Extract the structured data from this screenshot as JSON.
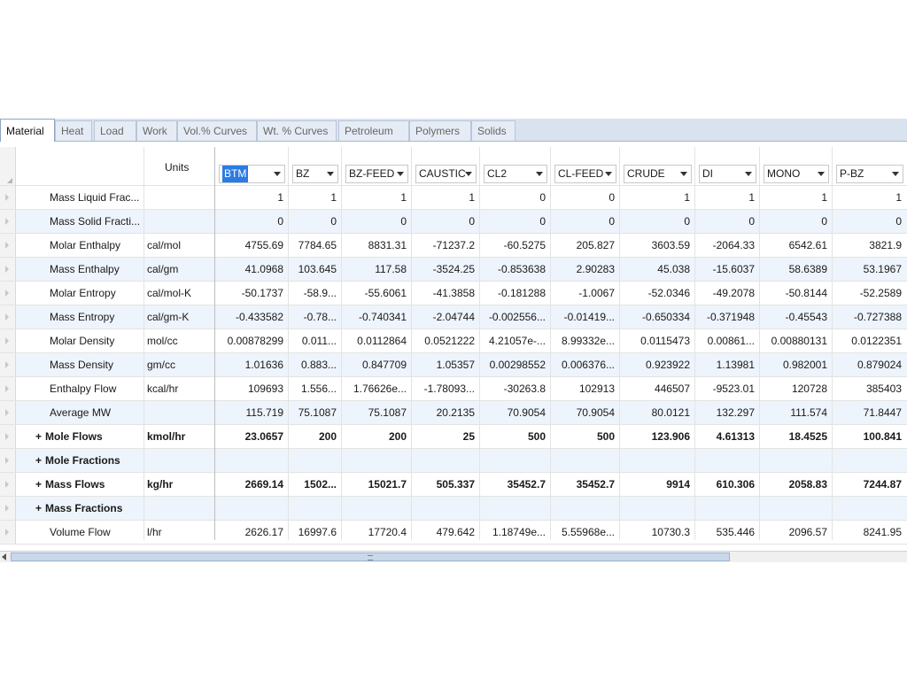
{
  "tabs": [
    {
      "label": "Material",
      "active": true
    },
    {
      "label": "Heat"
    },
    {
      "label": "Load"
    },
    {
      "label": "Work"
    },
    {
      "label": "Vol.% Curves"
    },
    {
      "label": "Wt. % Curves"
    },
    {
      "label": "Petroleum"
    },
    {
      "label": "Polymers"
    },
    {
      "label": "Solids"
    }
  ],
  "grid": {
    "units_header": "Units",
    "selected_stream": "BTM",
    "streams": [
      "BTM",
      "BZ",
      "BZ-FEED",
      "CAUSTIC",
      "CL2",
      "CL-FEED",
      "CRUDE",
      "DI",
      "MONO",
      "P-BZ"
    ],
    "rows": [
      {
        "label": "Mass Liquid Frac...",
        "unit": "",
        "values": [
          "1",
          "1",
          "1",
          "1",
          "0",
          "0",
          "1",
          "1",
          "1",
          "1"
        ]
      },
      {
        "label": "Mass Solid Fracti...",
        "unit": "",
        "values": [
          "0",
          "0",
          "0",
          "0",
          "0",
          "0",
          "0",
          "0",
          "0",
          "0"
        ]
      },
      {
        "label": "Molar Enthalpy",
        "unit": "cal/mol",
        "values": [
          "4755.69",
          "7784.65",
          "8831.31",
          "-71237.2",
          "-60.5275",
          "205.827",
          "3603.59",
          "-2064.33",
          "6542.61",
          "3821.9"
        ]
      },
      {
        "label": "Mass Enthalpy",
        "unit": "cal/gm",
        "values": [
          "41.0968",
          "103.645",
          "117.58",
          "-3524.25",
          "-0.853638",
          "2.90283",
          "45.038",
          "-15.6037",
          "58.6389",
          "53.1967"
        ]
      },
      {
        "label": "Molar Entropy",
        "unit": "cal/mol-K",
        "values": [
          "-50.1737",
          "-58.9...",
          "-55.6061",
          "-41.3858",
          "-0.181288",
          "-1.0067",
          "-52.0346",
          "-49.2078",
          "-50.8144",
          "-52.2589"
        ]
      },
      {
        "label": "Mass Entropy",
        "unit": "cal/gm-K",
        "values": [
          "-0.433582",
          "-0.78...",
          "-0.740341",
          "-2.04744",
          "-0.002556...",
          "-0.01419...",
          "-0.650334",
          "-0.371948",
          "-0.45543",
          "-0.727388"
        ]
      },
      {
        "label": "Molar Density",
        "unit": "mol/cc",
        "values": [
          "0.00878299",
          "0.011...",
          "0.0112864",
          "0.0521222",
          "4.21057e-...",
          "8.99332e...",
          "0.0115473",
          "0.00861...",
          "0.00880131",
          "0.0122351"
        ]
      },
      {
        "label": "Mass Density",
        "unit": "gm/cc",
        "values": [
          "1.01636",
          "0.883...",
          "0.847709",
          "1.05357",
          "0.00298552",
          "0.006376...",
          "0.923922",
          "1.13981",
          "0.982001",
          "0.879024"
        ]
      },
      {
        "label": "Enthalpy Flow",
        "unit": "kcal/hr",
        "values": [
          "109693",
          "1.556...",
          "1.76626e...",
          "-1.78093...",
          "-30263.8",
          "102913",
          "446507",
          "-9523.01",
          "120728",
          "385403"
        ]
      },
      {
        "label": "Average MW",
        "unit": "",
        "values": [
          "115.719",
          "75.1087",
          "75.1087",
          "20.2135",
          "70.9054",
          "70.9054",
          "80.0121",
          "132.297",
          "111.574",
          "71.8447"
        ]
      },
      {
        "label": "Mole Flows",
        "unit": "kmol/hr",
        "group": true,
        "values": [
          "23.0657",
          "200",
          "200",
          "25",
          "500",
          "500",
          "123.906",
          "4.61313",
          "18.4525",
          "100.841"
        ]
      },
      {
        "label": "Mole Fractions",
        "unit": "",
        "group": true,
        "values": [
          "",
          "",
          "",
          "",
          "",
          "",
          "",
          "",
          "",
          ""
        ]
      },
      {
        "label": "Mass Flows",
        "unit": "kg/hr",
        "group": true,
        "values": [
          "2669.14",
          "1502...",
          "15021.7",
          "505.337",
          "35452.7",
          "35452.7",
          "9914",
          "610.306",
          "2058.83",
          "7244.87"
        ]
      },
      {
        "label": "Mass Fractions",
        "unit": "",
        "group": true,
        "values": [
          "",
          "",
          "",
          "",
          "",
          "",
          "",
          "",
          "",
          ""
        ]
      },
      {
        "label": "Volume Flow",
        "unit": "l/hr",
        "values": [
          "2626.17",
          "16997.6",
          "17720.4",
          "479.642",
          "1.18749e...",
          "5.55968e...",
          "10730.3",
          "535.446",
          "2096.57",
          "8241.95"
        ]
      }
    ]
  }
}
